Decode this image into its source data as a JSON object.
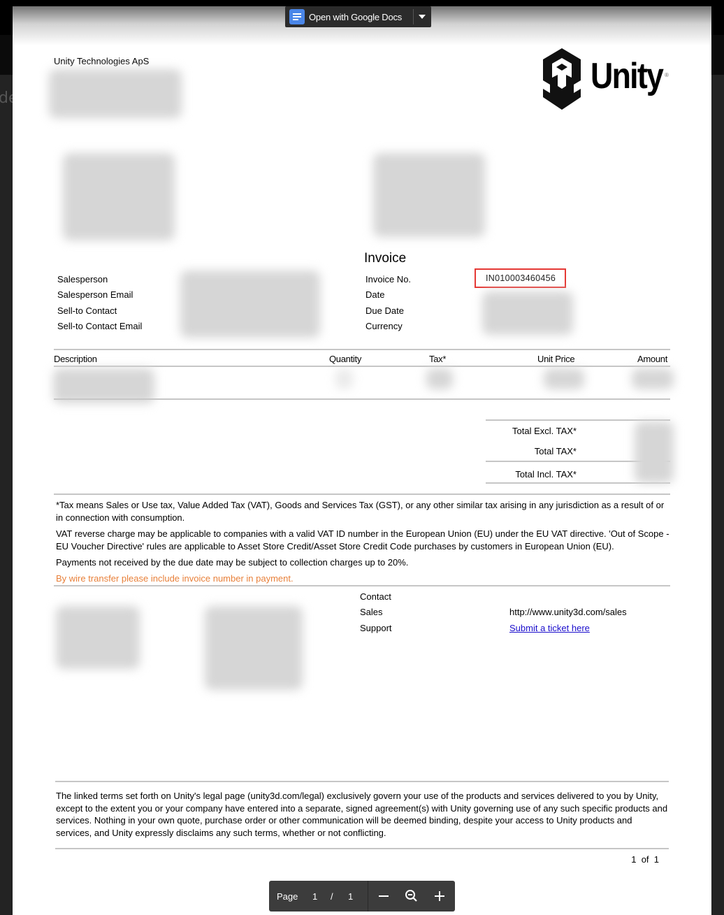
{
  "viewer": {
    "open_with_label": "Open with Google Docs",
    "background_partial_text": "de",
    "pager": {
      "label": "Page",
      "current": "1",
      "separator": "/",
      "total": "1"
    }
  },
  "invoice": {
    "seller_name": "Unity Technologies ApS",
    "logo_text": "Unity",
    "logo_reg": "®",
    "title": "Invoice",
    "left_fields": [
      {
        "label": "Salesperson",
        "value": ""
      },
      {
        "label": "Salesperson Email",
        "value": ""
      },
      {
        "label": "Sell-to Contact",
        "value": ""
      },
      {
        "label": "Sell-to Contact Email",
        "value": ""
      }
    ],
    "right_fields": [
      {
        "label": "Invoice No.",
        "value": "IN010003460456"
      },
      {
        "label": "Date",
        "value": ""
      },
      {
        "label": "Due Date",
        "value": ""
      },
      {
        "label": "Currency",
        "value": ""
      }
    ],
    "table": {
      "headers": [
        "Description",
        "Quantity",
        "Tax*",
        "Unit Price",
        "Amount"
      ]
    },
    "totals": [
      {
        "label": "Total Excl. TAX*"
      },
      {
        "label": "Total TAX*"
      },
      {
        "label": "Total Incl. TAX*"
      }
    ],
    "notes": {
      "tax_definition": "*Tax means Sales or Use tax, Value Added Tax (VAT), Goods and Services Tax (GST), or any other similar tax arising in any jurisdiction as a result of or in connection with consumption.",
      "vat_reverse": "VAT reverse charge may be applicable to companies with a valid VAT ID number in the European Union (EU) under the EU VAT directive. 'Out of Scope - EU Voucher Directive'  rules are applicable to Asset Store Credit/Asset Store Credit Code purchases by customers in European Union (EU).",
      "late_payment": "Payments not received by the due date may be subject to collection charges up to 20%.",
      "wire_transfer": "By wire transfer please include invoice number in payment."
    },
    "contact": {
      "heading": "Contact",
      "sales_label": "Sales",
      "sales_value": "http://www.unity3d.com/sales",
      "support_label": "Support",
      "support_link": "Submit a ticket here"
    },
    "legal": "The linked terms set forth on Unity's legal page (unity3d.com/legal) exclusively govern your use of the products and services delivered to you by Unity, except to the extent you or your company have entered into a separate, signed agreement(s) with Unity governing use of any such specific products and services. Nothing in your own quote, purchase order or other communication will be deemed binding, despite your access to Unity products and services, and Unity expressly disclaims any such terms, whether or not conflicting.",
    "page_footer": "1  of  1"
  },
  "colors": {
    "highlight_border": "#e53935",
    "wire_transfer_text": "#e8803a",
    "link": "#1a0dcc",
    "docs_icon": "#4a86e8"
  }
}
